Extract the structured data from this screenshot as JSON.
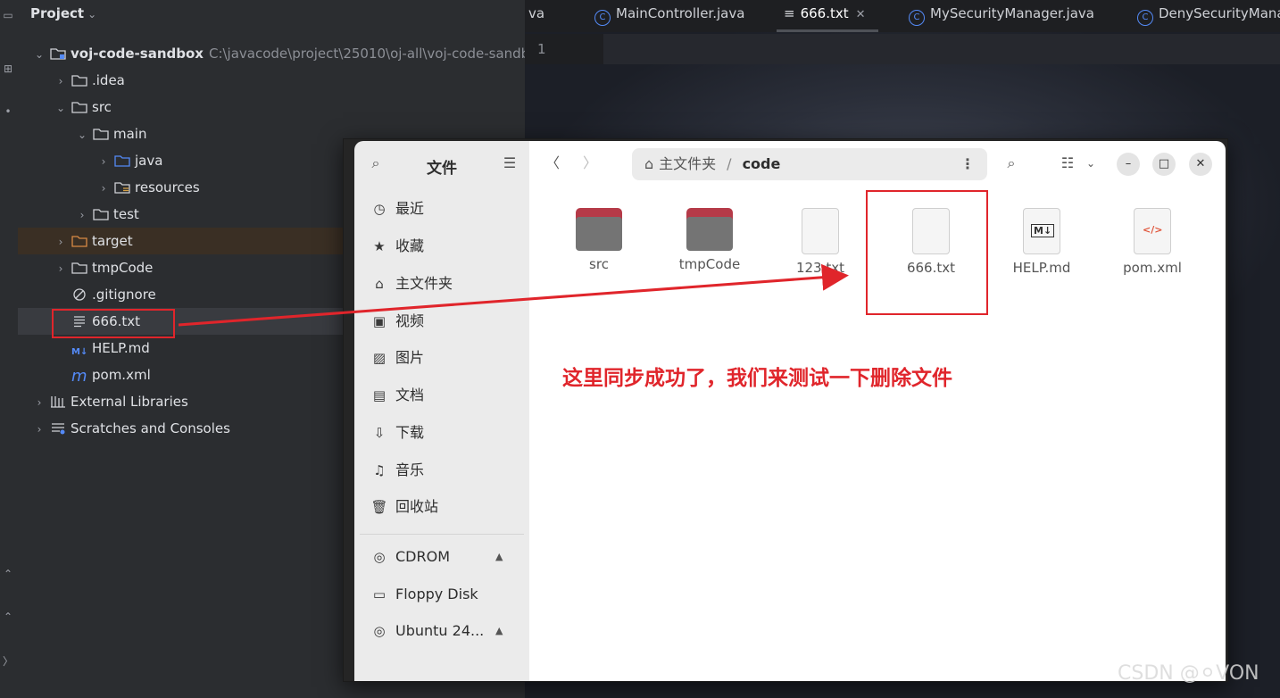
{
  "project": {
    "header": "Project",
    "tree": [
      {
        "label": "voj-code-sandbox",
        "path": "C:\\javacode\\project\\25010\\oj-all\\voj-code-sandb"
      },
      {
        "label": ".idea"
      },
      {
        "label": "src"
      },
      {
        "label": "main"
      },
      {
        "label": "java"
      },
      {
        "label": "resources"
      },
      {
        "label": "test"
      },
      {
        "label": "target"
      },
      {
        "label": "tmpCode"
      },
      {
        "label": ".gitignore"
      },
      {
        "label": "666.txt"
      },
      {
        "label": "HELP.md"
      },
      {
        "label": "pom.xml"
      },
      {
        "label": "External Libraries"
      },
      {
        "label": "Scratches and Consoles"
      }
    ]
  },
  "editor": {
    "tabs": [
      {
        "label": "va"
      },
      {
        "label": "MainController.java"
      },
      {
        "label": "666.txt"
      },
      {
        "label": "MySecurityManager.java"
      },
      {
        "label": "DenySecurityMana"
      }
    ],
    "line_number": "1"
  },
  "file_manager": {
    "title": "文件",
    "sidebar": [
      {
        "label": "最近",
        "icon": "clock-icon"
      },
      {
        "label": "收藏",
        "icon": "star-icon"
      },
      {
        "label": "主文件夹",
        "icon": "home-icon"
      },
      {
        "label": "视频",
        "icon": "video-icon"
      },
      {
        "label": "图片",
        "icon": "image-icon"
      },
      {
        "label": "文档",
        "icon": "document-icon"
      },
      {
        "label": "下载",
        "icon": "download-icon"
      },
      {
        "label": "音乐",
        "icon": "music-icon"
      },
      {
        "label": "回收站",
        "icon": "trash-icon"
      }
    ],
    "devices": [
      {
        "label": "CDROM"
      },
      {
        "label": "Floppy Disk"
      },
      {
        "label": "Ubuntu 24..."
      }
    ],
    "path": {
      "home": "主文件夹",
      "current": "code"
    },
    "files": [
      {
        "name": "src",
        "kind": "folder"
      },
      {
        "name": "tmpCode",
        "kind": "folder"
      },
      {
        "name": "123.txt",
        "kind": "text"
      },
      {
        "name": "666.txt",
        "kind": "text"
      },
      {
        "name": "HELP.md",
        "kind": "markdown"
      },
      {
        "name": "pom.xml",
        "kind": "xml"
      }
    ]
  },
  "annotation": {
    "note": "这里同步成功了，我们来测试一下删除文件",
    "color": "#e0252b"
  },
  "watermark": "CSDN @⚪VON"
}
